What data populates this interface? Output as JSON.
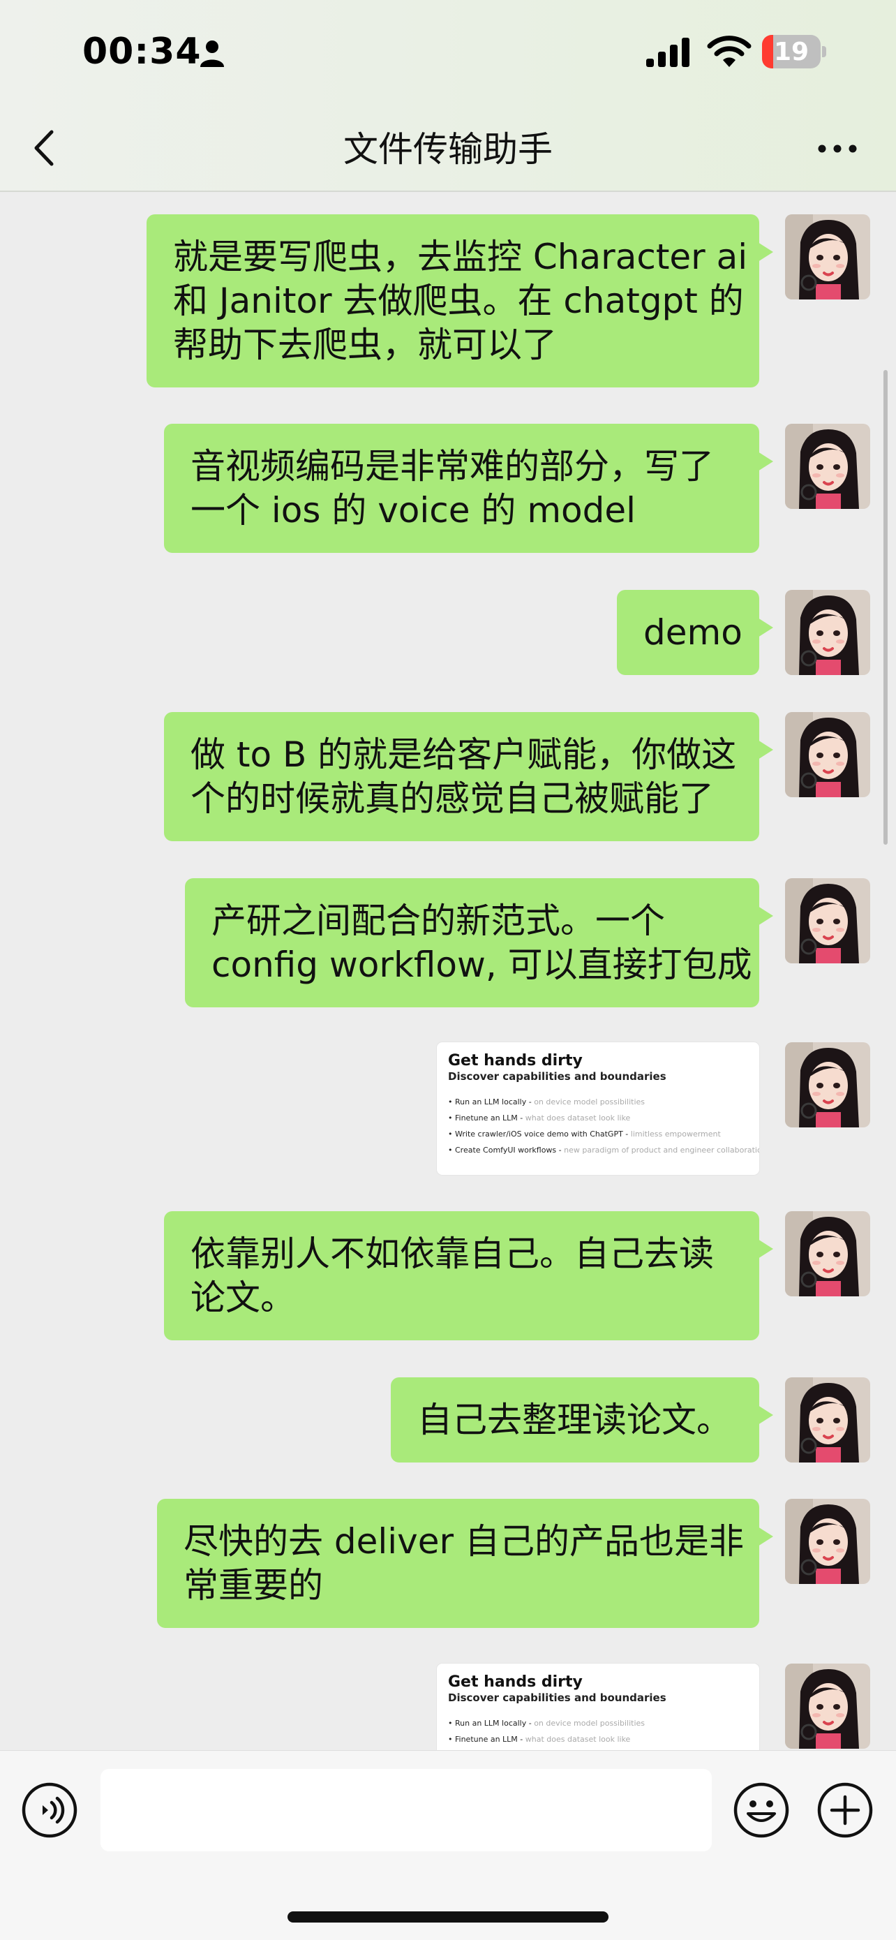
{
  "status": {
    "time": "00:34",
    "battery": "19",
    "battery_level": 0.19
  },
  "nav": {
    "title": "文件传输助手"
  },
  "icons": {
    "back": "chevron-left-icon",
    "more": "more-dots-icon",
    "voice": "voice-icon",
    "emoji": "emoji-icon",
    "plus": "plus-icon",
    "person": "person-icon",
    "signal": "signal-icon",
    "wifi": "wifi-icon"
  },
  "colors": {
    "bubble": "#a9ea7a",
    "background": "#ededed",
    "battery_low": "#ff3b30"
  },
  "messages": [
    {
      "lines": [
        "就是要写爬虫，去监控 Character ai",
        "和 Janitor 去做爬虫。在 chatgpt 的",
        "帮助下去爬虫，就可以了"
      ]
    },
    {
      "lines": [
        "音视频编码是非常难的部分，写了",
        "一个 ios 的 voice 的 model"
      ]
    },
    {
      "lines": [
        "demo"
      ]
    },
    {
      "lines": [
        "做 to B 的就是给客户赋能，你做这",
        "个的时候就真的感觉自己被赋能了"
      ]
    },
    {
      "lines": [
        "产研之间配合的新范式。一个",
        "config workflow, 可以直接打包成"
      ]
    },
    {
      "image": {
        "title": "Get hands dirty",
        "subtitle": "Discover capabilities and boundaries",
        "items": [
          {
            "main": "Run an LLM locally - ",
            "dim": "on device model possibilities"
          },
          {
            "main": "Finetune an LLM - ",
            "dim": "what does dataset look like"
          },
          {
            "main": "Write crawler/iOS voice demo with ChatGPT - ",
            "dim": "limitless empowerment"
          },
          {
            "main": "Create ComfyUI workflows - ",
            "dim": "new paradigm of product and engineer collaboration"
          }
        ]
      }
    },
    {
      "lines": [
        "依靠别人不如依靠自己。自己去读",
        "论文。"
      ]
    },
    {
      "lines": [
        "自己去整理读论文。"
      ]
    },
    {
      "lines": [
        "尽快的去 deliver 自己的产品也是非",
        "常重要的"
      ]
    },
    {
      "image": {
        "title": "Get hands dirty",
        "subtitle": "Discover capabilities and boundaries",
        "items": [
          {
            "main": "Run an LLM locally - ",
            "dim": "on device model possibilities"
          },
          {
            "main": "Finetune an LLM - ",
            "dim": "what does dataset look like"
          }
        ]
      }
    }
  ],
  "input": {
    "value": ""
  }
}
